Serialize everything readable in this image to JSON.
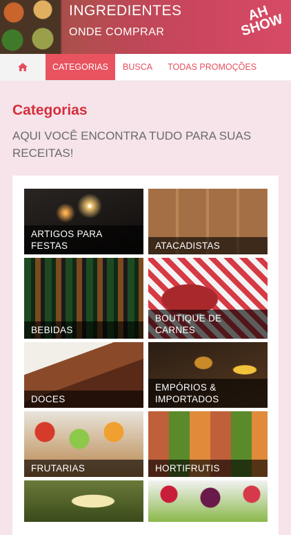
{
  "header": {
    "title": "INGREDIENTES",
    "subtitle": "ONDE COMPRAR",
    "logo_line1": "AH",
    "logo_line2": "SHOW"
  },
  "nav": {
    "home_icon": "home-icon",
    "items": [
      "CATEGORIAS",
      "BUSCA",
      "TODAS PROMOÇÕES"
    ],
    "active": "CATEGORIAS"
  },
  "page": {
    "heading": "Categorias",
    "description": "AQUI VOCÊ ENCONTRA TUDO PARA SUAS RECEITAS!"
  },
  "categories": [
    {
      "label": "ARTIGOS PARA FESTAS"
    },
    {
      "label": "ATACADISTAS"
    },
    {
      "label": "BEBIDAS"
    },
    {
      "label": "BOUTIQUE DE CARNES"
    },
    {
      "label": "DOCES"
    },
    {
      "label": "EMPÓRIOS & IMPORTADOS"
    },
    {
      "label": "FRUTARIAS"
    },
    {
      "label": "HORTIFRUTIS"
    },
    {
      "label": ""
    },
    {
      "label": ""
    }
  ],
  "colors": {
    "accent": "#e9525f",
    "heading": "#d42e3c",
    "background": "#f6e4ea"
  }
}
